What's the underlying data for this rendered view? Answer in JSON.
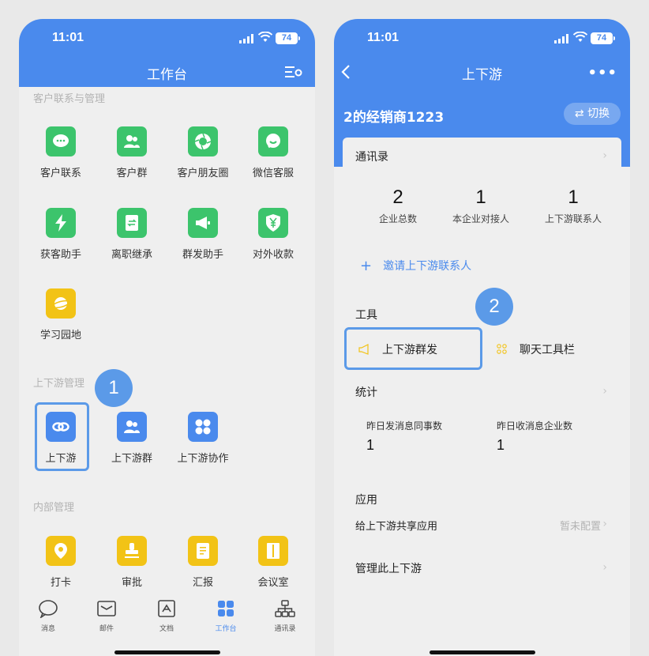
{
  "left": {
    "status": {
      "time": "11:01",
      "battery": "74"
    },
    "title": "工作台",
    "sections": [
      {
        "label": "客户联系与管理"
      },
      {
        "label": "上下游管理"
      },
      {
        "label": "内部管理"
      }
    ],
    "apps": [
      {
        "label": "客户联系",
        "icon": "chat-bubble-icon"
      },
      {
        "label": "客户群",
        "icon": "group-icon"
      },
      {
        "label": "客户朋友圈",
        "icon": "aperture-icon"
      },
      {
        "label": "微信客服",
        "icon": "wechat-service-icon"
      },
      {
        "label": "获客助手",
        "icon": "lightning-icon"
      },
      {
        "label": "离职继承",
        "icon": "transfer-icon"
      },
      {
        "label": "群发助手",
        "icon": "megaphone-icon"
      },
      {
        "label": "对外收款",
        "icon": "yuan-shield-icon"
      },
      {
        "label": "学习园地",
        "icon": "planet-icon"
      },
      {
        "label": "上下游",
        "icon": "link-icon"
      },
      {
        "label": "上下游群",
        "icon": "group-icon"
      },
      {
        "label": "上下游协作",
        "icon": "grid-icon"
      },
      {
        "label": "打卡",
        "icon": "location-pin-icon"
      },
      {
        "label": "审批",
        "icon": "stamp-icon"
      },
      {
        "label": "汇报",
        "icon": "report-icon"
      },
      {
        "label": "会议室",
        "icon": "door-icon"
      }
    ],
    "badge": "1",
    "tabs": [
      {
        "label": "消息",
        "icon": "message-icon"
      },
      {
        "label": "邮件",
        "icon": "mail-icon"
      },
      {
        "label": "文档",
        "icon": "document-icon"
      },
      {
        "label": "工作台",
        "icon": "workbench-icon"
      },
      {
        "label": "通讯录",
        "icon": "contacts-icon"
      }
    ]
  },
  "right": {
    "status": {
      "time": "11:01",
      "battery": "74"
    },
    "title": "上下游",
    "more": "•••",
    "corp_name": "2的经销商1223",
    "switch_label": "⇄ 切换",
    "contacts_label": "通讯录",
    "stats": [
      {
        "value": "2",
        "caption": "企业总数"
      },
      {
        "value": "1",
        "caption": "本企业对接人"
      },
      {
        "value": "1",
        "caption": "上下游联系人"
      }
    ],
    "invite_label": "邀请上下游联系人",
    "tools_label": "工具",
    "tools": [
      {
        "label": "上下游群发",
        "icon": "megaphone-icon"
      },
      {
        "label": "聊天工具栏",
        "icon": "toolbar-icon"
      }
    ],
    "badge": "2",
    "statistics_label": "统计",
    "statistics": [
      {
        "caption": "昨日发消息同事数",
        "value": "1"
      },
      {
        "caption": "昨日收消息企业数",
        "value": "1"
      }
    ],
    "apps_label": "应用",
    "share_label": "给上下游共享应用",
    "share_value": "暂未配置",
    "manage_label": "管理此上下游"
  },
  "colors": {
    "accent": "#4a8aed",
    "green": "#3cc46c",
    "yellow": "#f2c316",
    "highlight": "#5b9ae8"
  }
}
